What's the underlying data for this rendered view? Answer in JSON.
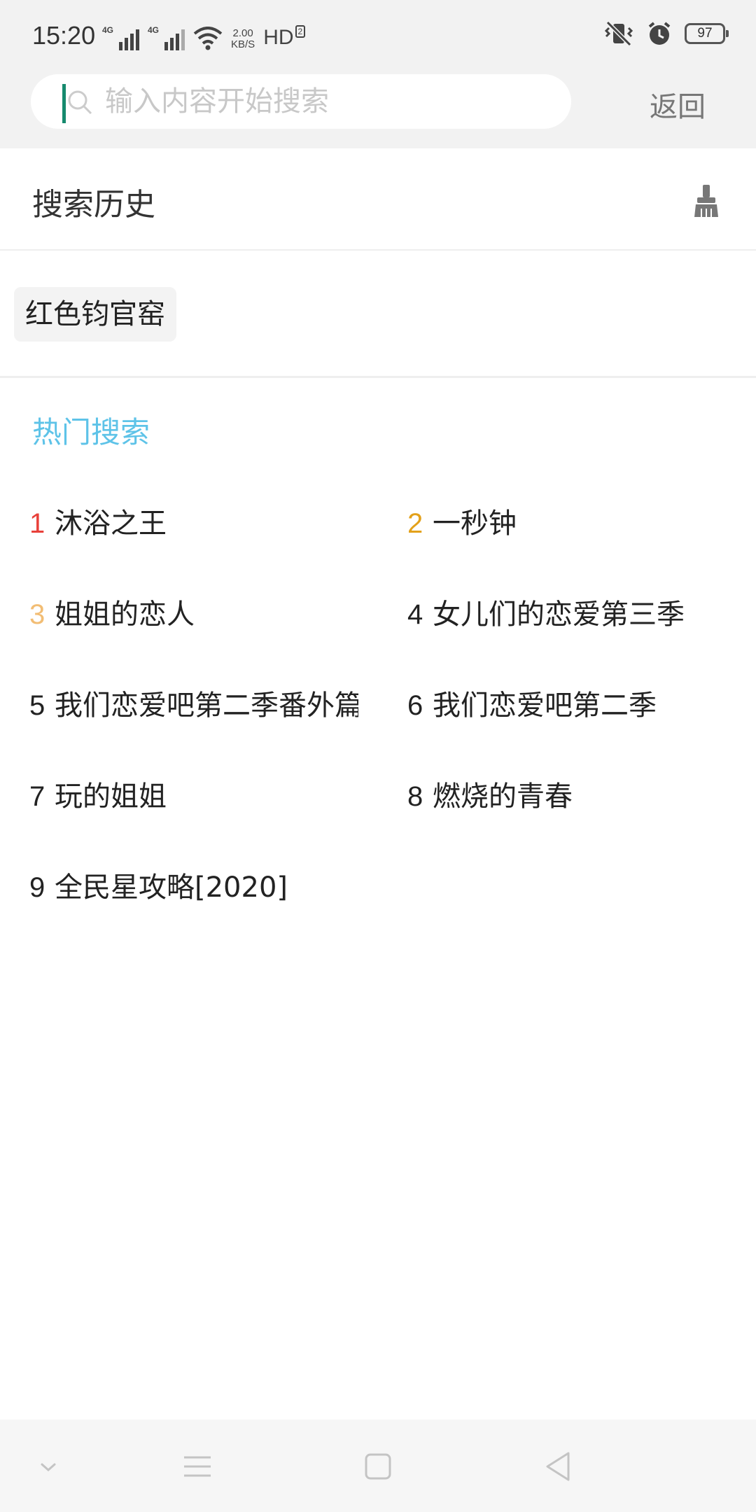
{
  "status_bar": {
    "time": "15:20",
    "network_1": "4G",
    "network_2": "4G",
    "speed_value": "2.00",
    "speed_unit": "KB/S",
    "hd_label": "HD",
    "hd_sub": "2",
    "battery": "97",
    "icons": [
      "signal-icon",
      "signal-icon",
      "wifi-icon",
      "vibrate-mute-icon",
      "alarm-icon",
      "battery-icon"
    ]
  },
  "search": {
    "placeholder": "输入内容开始搜索",
    "value": "",
    "back_label": "返回"
  },
  "history": {
    "title": "搜索历史",
    "clear_icon": "broom-icon",
    "items": [
      "红色钧官窑"
    ]
  },
  "hot": {
    "title": "热门搜索",
    "items": [
      {
        "rank": "1",
        "name": "沐浴之王",
        "rank_color": "#e8403a"
      },
      {
        "rank": "2",
        "name": "一秒钟",
        "rank_color": "#e3a11a"
      },
      {
        "rank": "3",
        "name": "姐姐的恋人",
        "rank_color": "#f2bd74"
      },
      {
        "rank": "4",
        "name": "女儿们的恋爱第三季",
        "rank_color": "#222222"
      },
      {
        "rank": "5",
        "name": "我们恋爱吧第二季番外篇",
        "rank_color": "#222222"
      },
      {
        "rank": "6",
        "name": "我们恋爱吧第二季",
        "rank_color": "#222222"
      },
      {
        "rank": "7",
        "name": "玩的姐姐",
        "rank_color": "#222222"
      },
      {
        "rank": "8",
        "name": "燃烧的青春",
        "rank_color": "#222222"
      },
      {
        "rank": "9",
        "name": "全民星攻略[2020]",
        "rank_color": "#222222"
      }
    ]
  },
  "nav_bar": {
    "icons": [
      "chevron-down-icon",
      "menu-icon",
      "home-square-icon",
      "back-triangle-icon"
    ]
  },
  "colors": {
    "accent": "#5ec3e8",
    "cursor": "#168a6e",
    "header_bg": "#f2f2f2"
  }
}
